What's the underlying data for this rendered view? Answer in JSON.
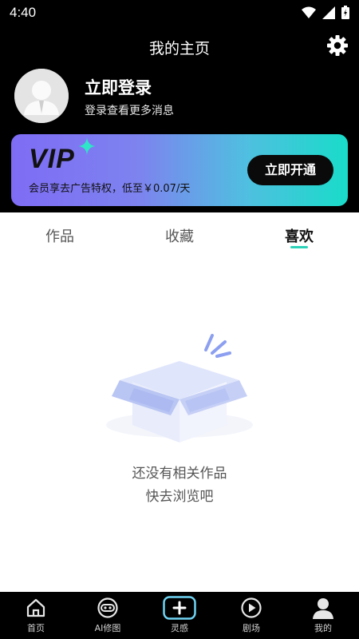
{
  "status": {
    "time": "4:40"
  },
  "header": {
    "title": "我的主页"
  },
  "profile": {
    "login_title": "立即登录",
    "login_subtitle": "登录查看更多消息"
  },
  "vip": {
    "logo": "VIP",
    "description": "会员享去广告特权，低至￥0.07/天",
    "button": "立即开通"
  },
  "tabs": [
    {
      "label": "作品",
      "active": false
    },
    {
      "label": "收藏",
      "active": false
    },
    {
      "label": "喜欢",
      "active": true
    }
  ],
  "empty": {
    "line1": "还没有相关作品",
    "line2": "快去浏览吧"
  },
  "bottom_nav": [
    {
      "label": "首页",
      "icon": "home-icon"
    },
    {
      "label": "AI修图",
      "icon": "gamepad-icon"
    },
    {
      "label": "灵感",
      "icon": "plus-icon"
    },
    {
      "label": "剧场",
      "icon": "play-icon"
    },
    {
      "label": "我的",
      "icon": "user-icon"
    }
  ],
  "colors": {
    "accent": "#2bd2b8",
    "vip_gradient_start": "#7e6cf5",
    "vip_gradient_end": "#19dcc9"
  }
}
